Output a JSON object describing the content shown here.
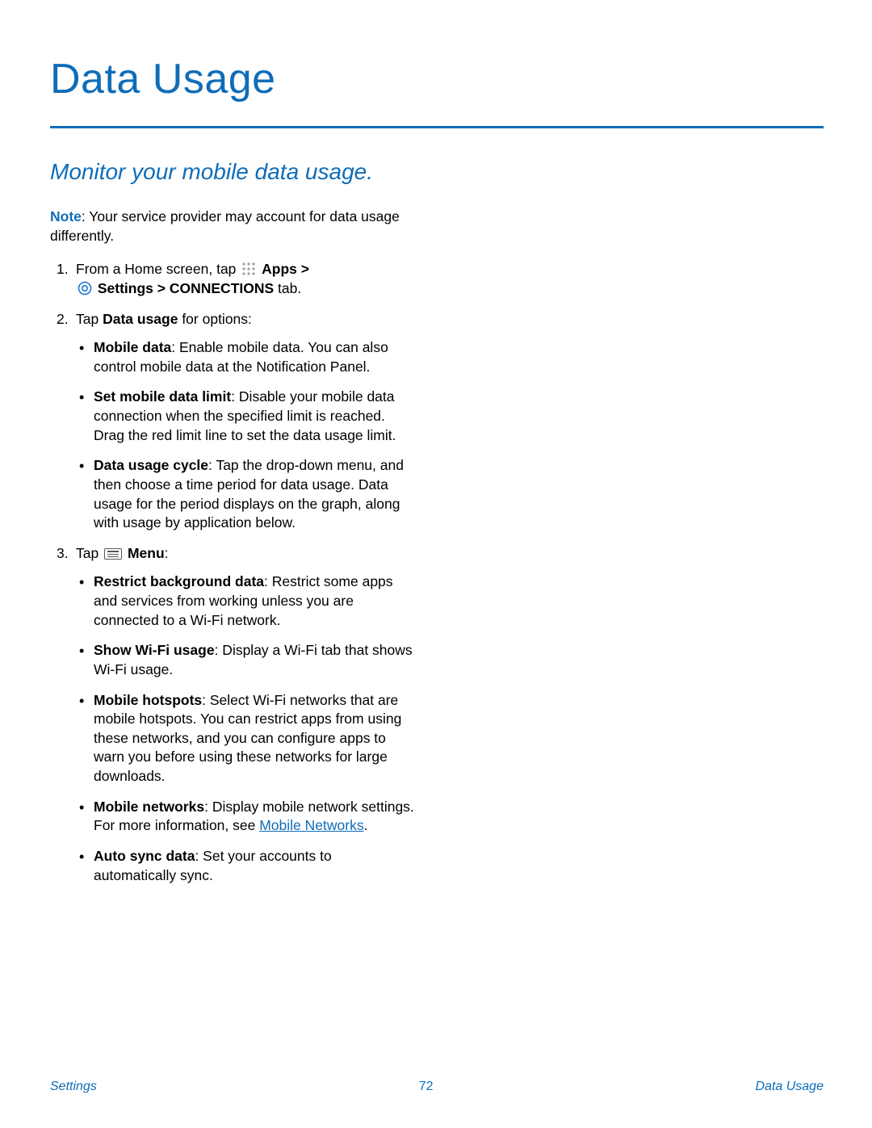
{
  "title": "Data Usage",
  "subtitle": "Monitor your mobile data usage.",
  "note": {
    "label": "Note",
    "text": ": Your service provider may account for data usage differently."
  },
  "steps": {
    "s1": {
      "prefix": "From a Home screen, tap ",
      "apps_bold": "Apps > ",
      "settings_bold": "Settings > CONNECTIONS",
      "settings_tail": " tab."
    },
    "s2": {
      "prefix": "Tap ",
      "bold": "Data usage",
      "tail": " for options:",
      "items": {
        "i0": {
          "bold": "Mobile data",
          "text": ": Enable mobile data. You can also control mobile data at the Notification Panel."
        },
        "i1": {
          "bold": "Set mobile data limit",
          "text": ": Disable your mobile data connection when the specified limit is reached. Drag the red limit line to set the data usage limit."
        },
        "i2": {
          "bold": "Data usage cycle",
          "text": ": Tap the drop-down menu, and then choose a time period for data usage. Data usage for the period displays on the graph, along with usage by application below."
        }
      }
    },
    "s3": {
      "prefix": "Tap ",
      "bold": "Menu",
      "tail": ":",
      "items": {
        "i0": {
          "bold": "Restrict background data",
          "text": ": Restrict some apps and services from working unless you are connected to a Wi-Fi network."
        },
        "i1": {
          "bold": "Show Wi-Fi usage",
          "text": ": Display a Wi-Fi tab that shows Wi-Fi usage."
        },
        "i2": {
          "bold": "Mobile hotspots",
          "text": ": Select Wi-Fi networks that are mobile hotspots. You can restrict apps from using these networks, and you can configure apps to warn you before using these networks for large downloads."
        },
        "i3": {
          "bold": "Mobile networks",
          "text": ": Display mobile network settings. For more information, see ",
          "link": "Mobile Networks",
          "post": "."
        },
        "i4": {
          "bold": "Auto sync data",
          "text": ": Set your accounts to automatically sync."
        }
      }
    }
  },
  "footer": {
    "left": "Settings",
    "center": "72",
    "right": "Data Usage"
  }
}
